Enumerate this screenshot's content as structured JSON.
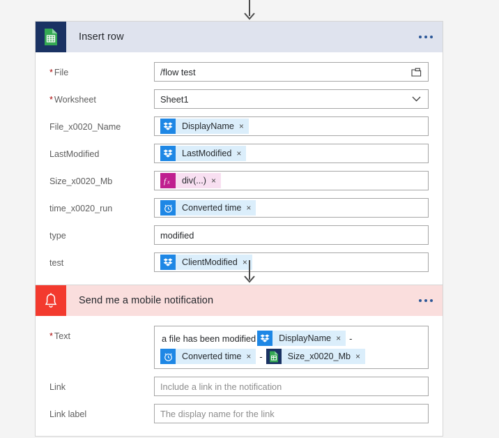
{
  "flow": {
    "arrows": [
      {
        "name": "arrow-to-insert-row"
      },
      {
        "name": "arrow-to-notification"
      }
    ],
    "steps": [
      {
        "id": "insert-row",
        "title": "Insert row",
        "icon": "google-sheets-icon",
        "header_color": "#dfe3ee",
        "icon_color": "#1a3263",
        "menu_label": "•••",
        "fields": [
          {
            "label": "File",
            "required": true,
            "kind": "text",
            "value": "/flow test",
            "affordance": "folder-picker-icon"
          },
          {
            "label": "Worksheet",
            "required": true,
            "kind": "text",
            "value": "Sheet1",
            "affordance": "chevron-down-icon"
          },
          {
            "label": "File_x0020_Name",
            "required": false,
            "kind": "tokens",
            "tokens": [
              {
                "type": "token",
                "icon": "dropbox-icon",
                "icon_class": "ti-dropbox",
                "body_class": "tb-blue",
                "text": "DisplayName",
                "remove": "×"
              }
            ]
          },
          {
            "label": "LastModified",
            "required": false,
            "kind": "tokens",
            "tokens": [
              {
                "type": "token",
                "icon": "dropbox-icon",
                "icon_class": "ti-dropbox",
                "body_class": "tb-blue",
                "text": "LastModified",
                "remove": "×"
              }
            ]
          },
          {
            "label": "Size_x0020_Mb",
            "required": false,
            "kind": "tokens",
            "tokens": [
              {
                "type": "token",
                "icon": "function-fx-icon",
                "icon_class": "ti-fx",
                "body_class": "tb-pink",
                "text": "div(...)",
                "remove": "×"
              }
            ]
          },
          {
            "label": "time_x0020_run",
            "required": false,
            "kind": "tokens",
            "tokens": [
              {
                "type": "token",
                "icon": "clock-icon",
                "icon_class": "ti-clock",
                "body_class": "tb-blue",
                "text": "Converted time",
                "remove": "×"
              }
            ]
          },
          {
            "label": "type",
            "required": false,
            "kind": "text",
            "value": "modified",
            "affordance": null
          },
          {
            "label": "test",
            "required": false,
            "kind": "tokens",
            "tokens": [
              {
                "type": "token",
                "icon": "dropbox-icon",
                "icon_class": "ti-dropbox",
                "body_class": "tb-blue",
                "text": "ClientModified",
                "remove": "×"
              }
            ]
          }
        ]
      },
      {
        "id": "send-mobile-notification",
        "title": "Send me a mobile notification",
        "icon": "bell-icon",
        "header_color": "#fadedd",
        "icon_color": "#f33a2e",
        "menu_label": "•••",
        "fields": [
          {
            "label": "Text",
            "required": true,
            "kind": "tokens",
            "multiline": true,
            "tokens": [
              {
                "type": "text",
                "text": "a file has been modified"
              },
              {
                "type": "token",
                "icon": "dropbox-icon",
                "icon_class": "ti-dropbox",
                "body_class": "tb-blue",
                "text": "DisplayName",
                "remove": "×"
              },
              {
                "type": "dash",
                "text": "-"
              },
              {
                "type": "token",
                "icon": "clock-icon",
                "icon_class": "ti-clock",
                "body_class": "tb-blue",
                "text": "Converted time",
                "remove": "×"
              },
              {
                "type": "dash",
                "text": "-"
              },
              {
                "type": "token",
                "icon": "google-sheets-icon",
                "icon_class": "ti-sheets",
                "body_class": "tb-blue",
                "text": "Size_x0020_Mb",
                "remove": "×"
              }
            ]
          },
          {
            "label": "Link",
            "required": false,
            "kind": "text",
            "value": "",
            "placeholder": "Include a link in the notification",
            "affordance": null
          },
          {
            "label": "Link label",
            "required": false,
            "kind": "text",
            "value": "",
            "placeholder": "The display name for the link",
            "affordance": null
          }
        ]
      }
    ]
  }
}
